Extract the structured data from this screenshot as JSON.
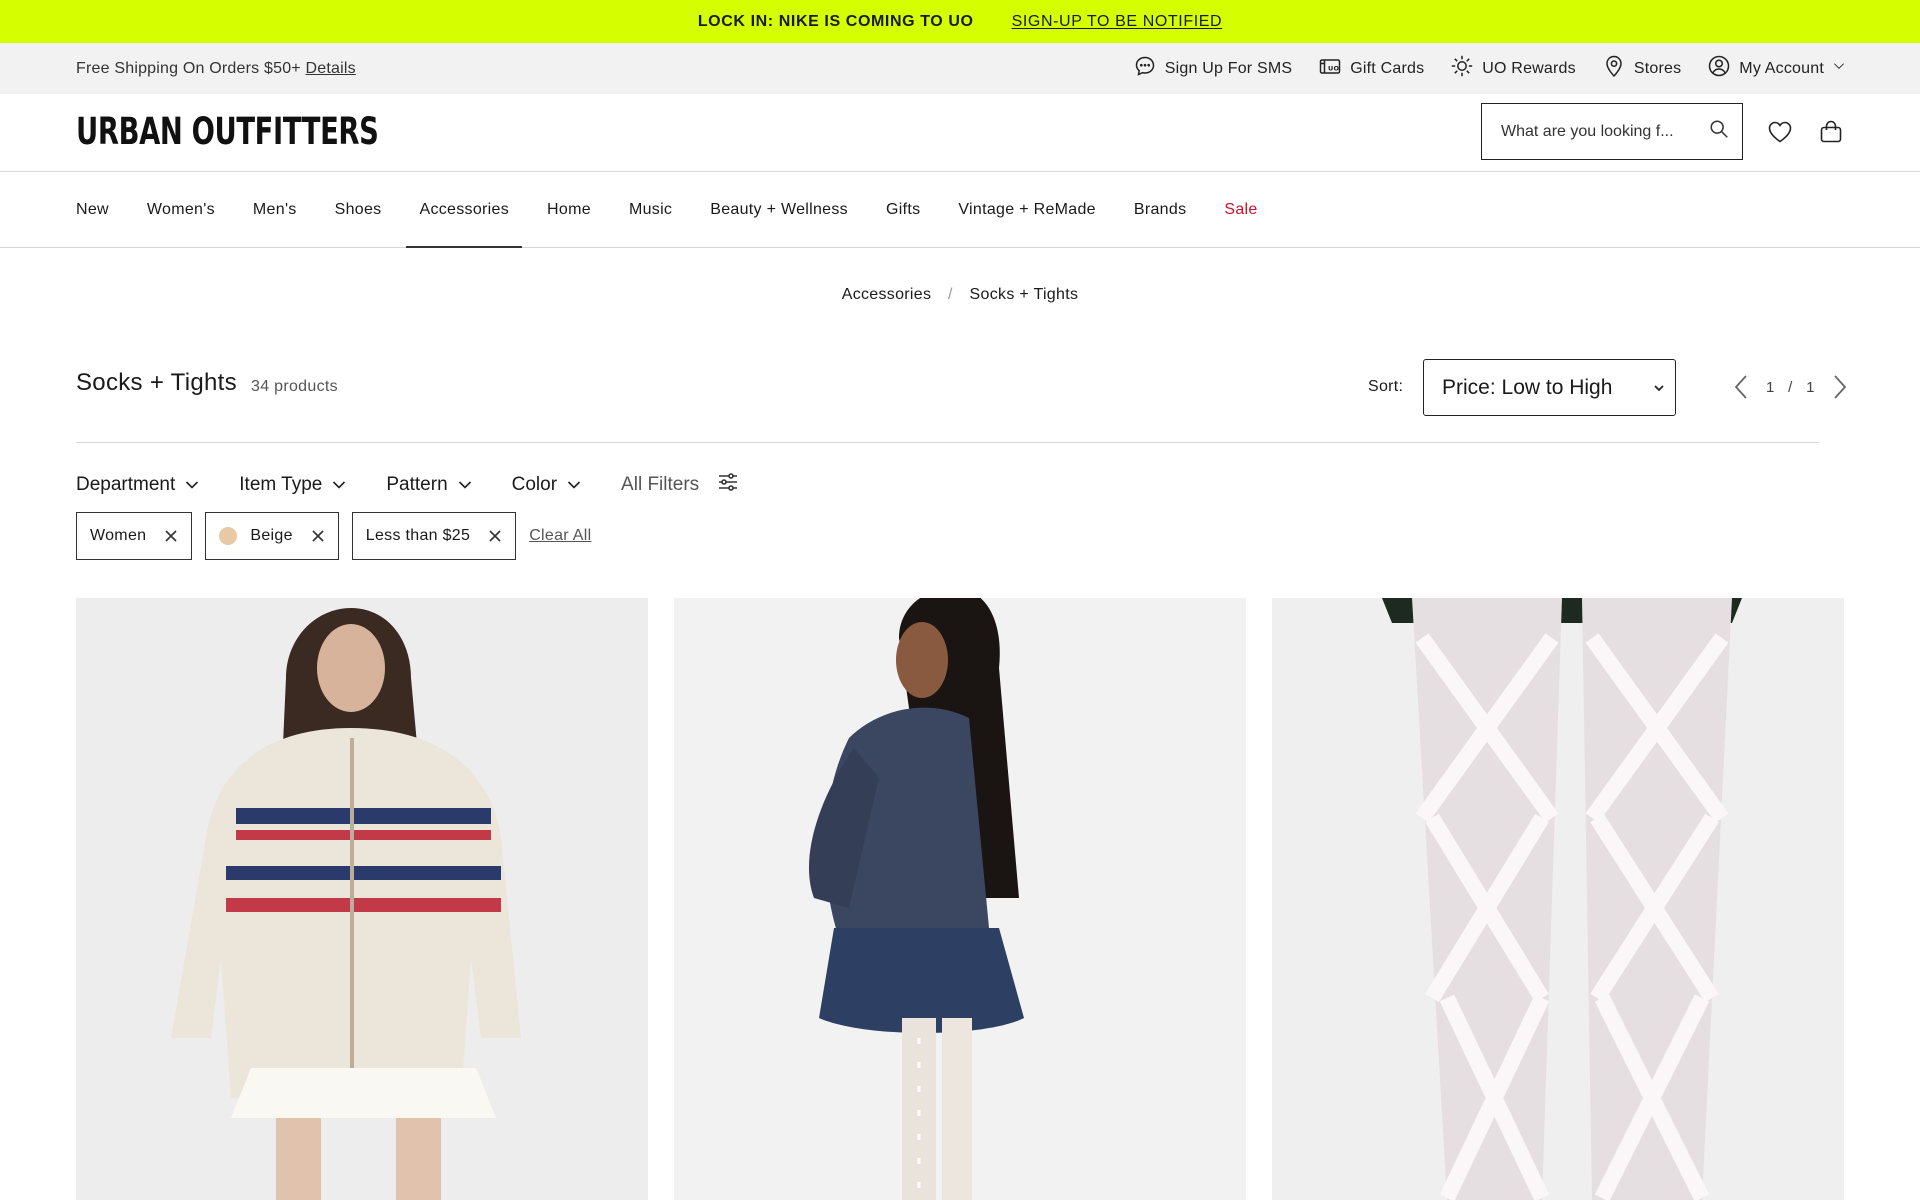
{
  "promo": {
    "headline": "LOCK IN: NIKE IS COMING TO UO",
    "link": "SIGN-UP TO BE NOTIFIED"
  },
  "utility": {
    "shipping_text": "Free Shipping On Orders $50+",
    "details_link": "Details",
    "links": [
      {
        "label": "Sign Up For SMS",
        "icon": "chat-bubble-icon"
      },
      {
        "label": "Gift Cards",
        "icon": "gift-card-icon"
      },
      {
        "label": "UO Rewards",
        "icon": "sun-icon"
      },
      {
        "label": "Stores",
        "icon": "location-pin-icon"
      },
      {
        "label": "My Account",
        "icon": "user-circle-icon"
      }
    ]
  },
  "header": {
    "logo": "URBAN OUTFITTERS",
    "search_placeholder": "What are you looking f..."
  },
  "nav": {
    "items": [
      "New",
      "Women's",
      "Men's",
      "Shoes",
      "Accessories",
      "Home",
      "Music",
      "Beauty + Wellness",
      "Gifts",
      "Vintage + ReMade",
      "Brands",
      "Sale"
    ],
    "active": "Accessories",
    "sale_color": "#c8102e"
  },
  "breadcrumb": {
    "parent": "Accessories",
    "separator": "/",
    "current": "Socks + Tights"
  },
  "listing": {
    "title": "Socks + Tights",
    "count": "34 products",
    "sort_label": "Sort:",
    "sort_value": "Price: Low to High",
    "page_current": "1",
    "page_sep": "/",
    "page_total": "1"
  },
  "filters": {
    "items": [
      "Department",
      "Item Type",
      "Pattern",
      "Color"
    ],
    "all_filters": "All Filters"
  },
  "active_filters": {
    "chips": [
      {
        "label": "Women"
      },
      {
        "label": "Beige",
        "swatch": "#e9c9a3"
      },
      {
        "label": "Less than $25"
      }
    ],
    "clear_all": "Clear All"
  },
  "colors": {
    "promo_bg": "#d5ff00",
    "utility_bg": "#f2f2f2",
    "sale": "#c8102e"
  }
}
